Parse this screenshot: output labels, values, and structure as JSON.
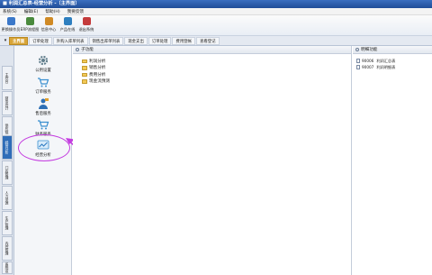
{
  "window": {
    "title": "■ 利润汇总表-经营分析 -〔主界面〕"
  },
  "menu": {
    "items": [
      "系统(S)",
      "编辑(E)",
      "帮助(H)",
      "我要反馈"
    ]
  },
  "toolbar": {
    "items": [
      {
        "label": "更换操作员",
        "icon": "user-switch-icon",
        "color": "#3b78c9"
      },
      {
        "label": "ERP流程图",
        "icon": "flowchart-icon",
        "color": "#4a8a3d"
      },
      {
        "label": "信息中心",
        "icon": "info-center-icon",
        "color": "#d08a25"
      },
      {
        "label": "产品在线",
        "icon": "product-online-icon",
        "color": "#2e7fbf"
      },
      {
        "label": "退出系统",
        "icon": "exit-icon",
        "color": "#c43b3b"
      }
    ]
  },
  "tabs": [
    {
      "label": "主界面",
      "active": true
    },
    {
      "label": "订单处理",
      "active": false
    },
    {
      "label": "外购入库单列表",
      "active": false
    },
    {
      "label": "销售出库单列表",
      "active": false
    },
    {
      "label": "现金支出",
      "active": false
    },
    {
      "label": "订单处理",
      "active": false
    },
    {
      "label": "费用登帐",
      "active": false
    },
    {
      "label": "查看登记",
      "active": false
    }
  ],
  "side_tabs": [
    "主控台",
    "财务会计",
    "供应链",
    "经营分析",
    "门店管理",
    "人力资源",
    "生产管理",
    "内控管理",
    "系统设置"
  ],
  "modules": [
    {
      "label": "公用设置",
      "icon": "gear-icon",
      "color": "#607d8b"
    },
    {
      "label": "订单服务",
      "icon": "cart-icon",
      "color": "#3a8fd0"
    },
    {
      "label": "售后服务",
      "icon": "support-icon",
      "color": "#2d6fb5"
    },
    {
      "label": "财务服务",
      "icon": "finance-icon",
      "color": "#3a8fd0"
    },
    {
      "label": "经营分析",
      "icon": "analysis-icon",
      "color": "#3a8fd0"
    }
  ],
  "main_panel": {
    "header": "子功能",
    "folders": [
      "利润分析",
      "销售分析",
      "费用分析",
      "现金流预测"
    ]
  },
  "right_panel": {
    "header": "明细功能",
    "items": [
      {
        "code": "90006",
        "name": "利润汇总表"
      },
      {
        "code": "90007",
        "name": "利润明细表"
      }
    ]
  },
  "accent": {
    "highlight": "#c43de0",
    "active_tab": "#d9a537",
    "title_bar": "#2a5ba8"
  }
}
